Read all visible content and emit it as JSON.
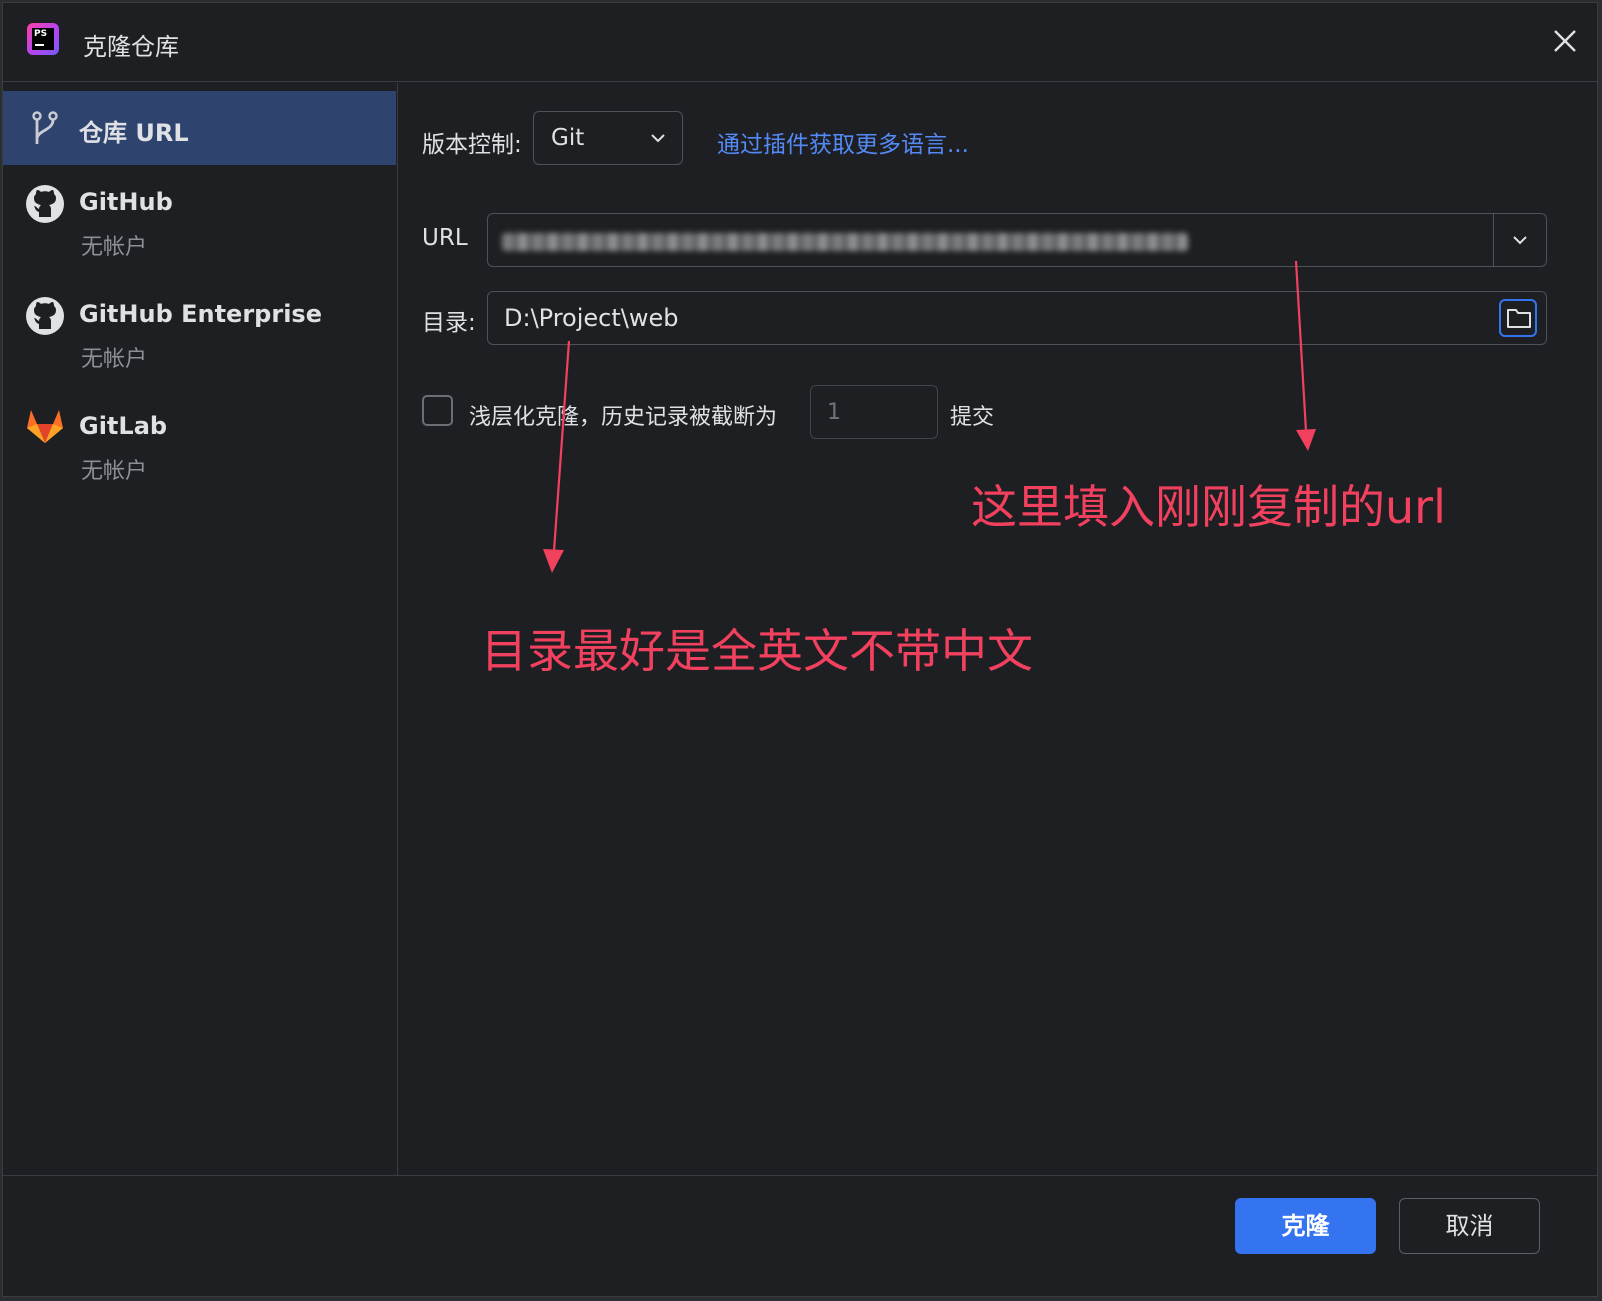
{
  "window": {
    "title": "克隆仓库",
    "app_icon_text": "PS"
  },
  "sidebar": {
    "items": [
      {
        "label": "仓库 URL",
        "icon": "branch-icon",
        "selected": true
      },
      {
        "label": "GitHub",
        "sub": "无帐户",
        "icon": "github-icon"
      },
      {
        "label": "GitHub Enterprise",
        "sub": "无帐户",
        "icon": "github-icon"
      },
      {
        "label": "GitLab",
        "sub": "无帐户",
        "icon": "gitlab-icon"
      }
    ]
  },
  "form": {
    "vcs_label": "版本控制:",
    "vcs_value": "Git",
    "plugin_link": "通过插件获取更多语言...",
    "url_label": "URL",
    "dir_label": "目录:",
    "dir_value": "D:\\Project\\web",
    "shallow_label": "浅层化克隆，历史记录被截断为",
    "shallow_checked": false,
    "depth_value": "1",
    "commits_label": "提交"
  },
  "annotations": {
    "url_hint": "这里填入刚刚复制的url",
    "dir_hint": "目录最好是全英文不带中文",
    "color": "#f2405f"
  },
  "footer": {
    "clone_label": "克隆",
    "cancel_label": "取消"
  },
  "colors": {
    "accent": "#3574f0",
    "link": "#548af7",
    "selected_bg": "#2e436e",
    "bg": "#1e1f22"
  }
}
